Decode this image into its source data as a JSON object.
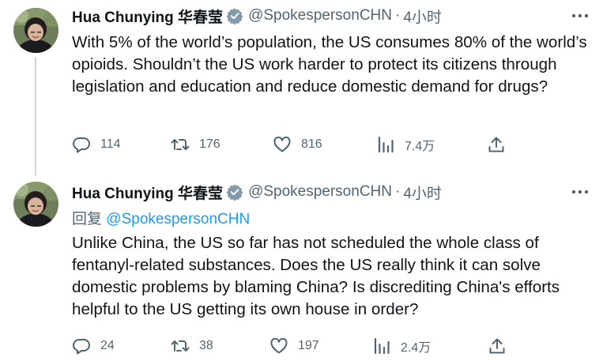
{
  "tweets": [
    {
      "display_name": "Hua Chunying 华春莹",
      "handle": "@SpokespersonCHN",
      "separator": "·",
      "time": "4小时",
      "replying_prefix": "",
      "replying_to": "",
      "text": "With 5% of the world’s population, the US consumes 80% of the world’s opioids. Shouldn’t the US work harder to protect its citizens through legislation and education and reduce domestic demand for drugs?",
      "replies": "114",
      "retweets": "176",
      "likes": "816",
      "views": "7.4万"
    },
    {
      "display_name": "Hua Chunying 华春莹",
      "handle": "@SpokespersonCHN",
      "separator": "·",
      "time": "4小时",
      "replying_prefix": "回复",
      "replying_to": "@SpokespersonCHN",
      "text": "Unlike China, the US so far has not scheduled the whole class of fentanyl-related substances. Does the US really think it can solve domestic problems by blaming China? Is discrediting China's efforts helpful to the US getting its own house in order?",
      "replies": "24",
      "retweets": "38",
      "likes": "197",
      "views": "2.4万"
    }
  ],
  "colors": {
    "text": "#0f1419",
    "secondary": "#536471",
    "link": "#1d9bf0",
    "verified_badge": "#829aab",
    "thread_line": "#cfd9de"
  },
  "icons": {
    "verified": "verified-badge-icon",
    "more": "more-icon",
    "reply": "reply-icon",
    "retweet": "retweet-icon",
    "like": "heart-icon",
    "views": "views-icon",
    "share": "share-icon"
  }
}
